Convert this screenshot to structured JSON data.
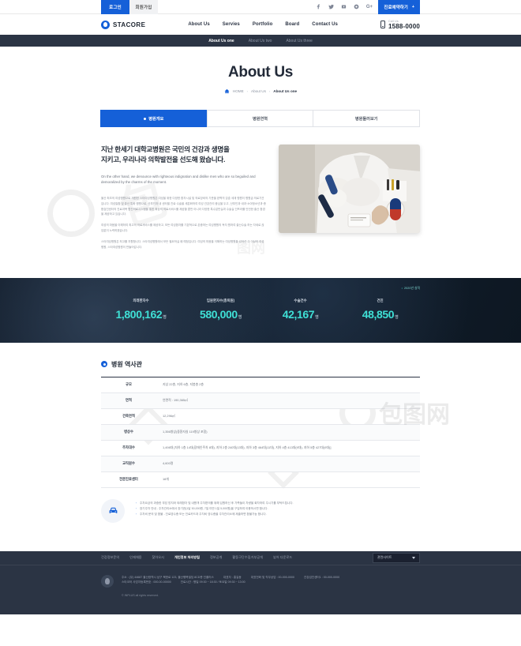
{
  "topbar": {
    "login": "로그인",
    "join": "회원가입",
    "social": [
      "facebook-icon",
      "twitter-icon",
      "youtube-icon",
      "instagram-icon",
      "googleplus-icon"
    ],
    "reserve_label": "진료예약하기",
    "reserve_plus": "+"
  },
  "header": {
    "logo_text": "STACORE",
    "nav": [
      "About Us",
      "Servies",
      "Portfolio",
      "Board",
      "Contact Us"
    ],
    "call_label": "Call Us",
    "call_number": "1588-0000"
  },
  "subnav": {
    "items": [
      "About Us one",
      "About Us two",
      "About Us three"
    ],
    "active": "About Us one"
  },
  "page": {
    "title": "About Us",
    "breadcrumb": [
      "HOME",
      "About Us",
      "About Us one"
    ],
    "breadcrumb_sep": "›"
  },
  "tabs": [
    {
      "label": "병원개요",
      "active": true
    },
    {
      "label": "병원연혁",
      "active": false
    },
    {
      "label": "병원둘러보기",
      "active": false
    }
  ],
  "intro": {
    "heading_line1": "지난 한세기 대학교병원은 국민의 건강과 생명을",
    "heading_line2": "지키고, 우리나라 의학발전을 선도해 왔습니다.",
    "sub": "On the other hand, we denounce with righteous indignation and dislike men who are so beguiled and demoralized by the charms of the moment.",
    "paragraphs": [
      "울산 최초의 여성병원으로 개원한 스타여성병원은 여성을 위한 다양한 환자시설 및 의료장비의 기준을 완벽히 갖춘 세계 병원이 병원급 의료기관입니다. 여성질환 및 출산 특화 병원으로, 산부인과 내 센터별 진료·수술을 세분화하여 여성 건강관리 중심을 두고, 산부인과·내과·소아청소년과·종합검진센터의 진료과목 협진의료시스템을 통한 최상의 의료서비스를 제공할 뿐만 아니라 다양한 특수분만실과 수술실 인프라를 안전한 출산 환경을 제공하고 있습니다.",
      "여성의 마음을 이해하여 최고의 의료서비스를 제공하고, 모든 여성환자를 기본적으로 존중하는 여성병원의 독자 원하여 출산수술 하는 자세로 끊임없이 노력하겠습니다.",
      "스타여성병원은 최고를 지향합니다. 스타여성병원에서 모든 필요하실 때 예정입니다. 여성의 마음을 이해하는 여성병원을 넘어선 그 이상의 여성병원, 스타여성병원이 만들어갑니다."
    ],
    "photo_alt": "doctor-holding-instrument-photo"
  },
  "stats": {
    "year_note": "2020년 실적",
    "items": [
      {
        "label": "외래환자수",
        "value": "1,800,162",
        "unit": "명"
      },
      {
        "label": "입원환자수(총퇴원)",
        "value": "580,000",
        "unit": "명"
      },
      {
        "label": "수술건수",
        "value": "42,167",
        "unit": "명"
      },
      {
        "label": "건진",
        "value": "48,850",
        "unit": "명"
      }
    ]
  },
  "history": {
    "section_title": "병원 역사관",
    "rows": [
      {
        "label": "규모",
        "value": "지상 22층, 지하 6층, 지붕층 2층"
      },
      {
        "label": "면적",
        "value": "연면적 : 190,365㎡"
      },
      {
        "label": "건축면적",
        "value": "12,296㎡"
      },
      {
        "label": "병상수",
        "value": "1,356병상(중환자실 119병상 포함)"
      },
      {
        "label": "주차대수",
        "value": "1,498대 [지하 1층 14대(장애인주차 8대), 지하 2층 240대(13대), 지하 3층 464대(11대), 지하 4층 413대(9대), 지하 5층 427대(9대)]"
      },
      {
        "label": "교직원수",
        "value": "4,600명"
      },
      {
        "label": "전문진료센터",
        "value": "18개"
      }
    ]
  },
  "notes": {
    "icon": "car-icon",
    "items": [
      "주차요금의 과중한 부담 방지와 외래환자 및 내원객 주차편의를 위해 입원하신 후 가족들이 차량을 회차하여 주시기를 부탁드립니다.",
      "장기주차 안내 - 주차관리소에서 장기권(1달 50,000원, 7일 미만 1일 5,000원)을 구입하여 이용하시면 합니다.",
      "주차비 문의 및 환불 - 진료영수증 또는 진료카드과 주차비 영수증을 주차관리소에 제출하면 환불가능 합니다."
    ]
  },
  "footer": {
    "links": [
      {
        "label": "건강정보문의",
        "emphasis": false
      },
      {
        "label": "인재채용",
        "emphasis": false
      },
      {
        "label": "찾아오시",
        "emphasis": false
      },
      {
        "label": "개인정보 처리방침",
        "emphasis": true
      },
      {
        "label": "정보공개",
        "emphasis": false
      },
      {
        "label": "활동구단수집거부공개",
        "emphasis": false
      },
      {
        "label": "뷰어 다운로드",
        "emphasis": false
      }
    ],
    "select_label": "관련사이트",
    "address_line1": "주소 : (우) 44687 울산광역시 남구 북한로 123, 울산행복빌딩 8CD층 인플러스",
    "address_items1": [
      "대표자 : 홍길동",
      "대표전화 및 직무상담 : 00-000-0000",
      "건강검진센터1 : 00-000-0000"
    ],
    "address_line2": "스타코어 사업자등록번호 : 000-00-00000",
    "address_items2": [
      "진료시간 : 평일 09:30 ~ 18:30 / 토요일 09:30 ~ 13:00"
    ],
    "copyright": "© INPLUS all rights reserved."
  }
}
